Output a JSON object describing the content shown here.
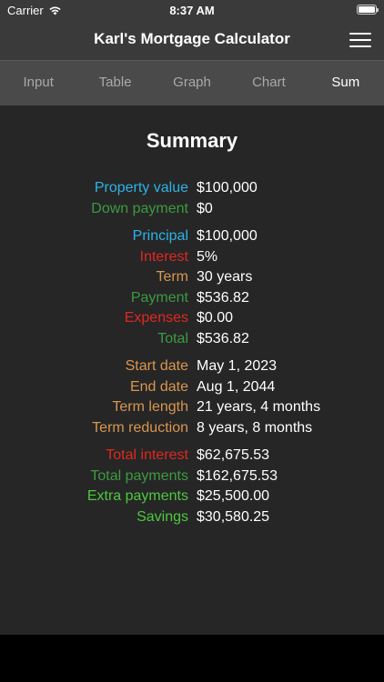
{
  "status": {
    "carrier": "Carrier",
    "time": "8:37 AM"
  },
  "nav": {
    "title": "Karl's Mortgage Calculator"
  },
  "tabs": [
    {
      "label": "Input",
      "active": false
    },
    {
      "label": "Table",
      "active": false
    },
    {
      "label": "Graph",
      "active": false
    },
    {
      "label": "Chart",
      "active": false
    },
    {
      "label": "Sum",
      "active": true
    }
  ],
  "summary": {
    "title": "Summary",
    "groups": [
      [
        {
          "label": "Property value",
          "value": "$100,000",
          "color": "#2bb3e6"
        },
        {
          "label": "Down payment",
          "value": "$0",
          "color": "#3c9a41"
        }
      ],
      [
        {
          "label": "Principal",
          "value": "$100,000",
          "color": "#2bb3e6"
        },
        {
          "label": "Interest",
          "value": "5%",
          "color": "#e0281f"
        },
        {
          "label": "Term",
          "value": "30 years",
          "color": "#d9964f"
        },
        {
          "label": "Payment",
          "value": "$536.82",
          "color": "#3c9a41"
        },
        {
          "label": "Expenses",
          "value": "$0.00",
          "color": "#e0281f"
        },
        {
          "label": "Total",
          "value": "$536.82",
          "color": "#3c9a41"
        }
      ],
      [
        {
          "label": "Start date",
          "value": "May 1, 2023",
          "color": "#d9964f"
        },
        {
          "label": "End date",
          "value": "Aug 1, 2044",
          "color": "#d9964f"
        },
        {
          "label": "Term length",
          "value": "21 years, 4 months",
          "color": "#d9964f"
        },
        {
          "label": "Term reduction",
          "value": "8 years, 8 months",
          "color": "#d9964f"
        }
      ],
      [
        {
          "label": "Total interest",
          "value": "$62,675.53",
          "color": "#e0281f"
        },
        {
          "label": "Total payments",
          "value": "$162,675.53",
          "color": "#3c9a41"
        },
        {
          "label": "Extra payments",
          "value": "$25,500.00",
          "color": "#4cc93f"
        },
        {
          "label": "Savings",
          "value": "$30,580.25",
          "color": "#4cc93f"
        }
      ]
    ]
  },
  "icons": {
    "wifi": "wifi-icon",
    "battery": "battery-icon",
    "menu": "hamburger-menu-icon"
  }
}
